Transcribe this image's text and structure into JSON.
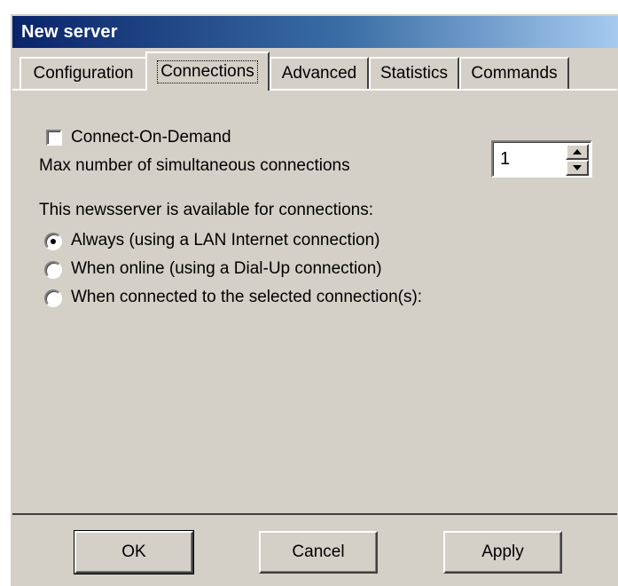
{
  "window": {
    "title": "New server"
  },
  "tabs": [
    {
      "label": "Configuration",
      "active": false
    },
    {
      "label": "Connections",
      "active": true
    },
    {
      "label": "Advanced",
      "active": false
    },
    {
      "label": "Statistics",
      "active": false
    },
    {
      "label": "Commands",
      "active": false
    }
  ],
  "connections": {
    "connect_on_demand": {
      "label": "Connect-On-Demand",
      "checked": false
    },
    "max_connections": {
      "label": "Max number of simultaneous connections",
      "value": "1"
    },
    "availability_heading": "This newsserver is available for connections:",
    "availability_options": [
      {
        "label": "Always (using a LAN Internet connection)",
        "selected": true
      },
      {
        "label": "When online (using a Dial-Up connection)",
        "selected": false
      },
      {
        "label": "When connected to the selected connection(s):",
        "selected": false
      }
    ]
  },
  "buttons": {
    "ok": "OK",
    "cancel": "Cancel",
    "apply": "Apply"
  },
  "colors": {
    "face": "#d4d0c8",
    "title_start": "#0a246a",
    "title_end": "#a6caf0"
  },
  "icons": {
    "spin_up": "arrow-up-icon",
    "spin_down": "arrow-down-icon"
  }
}
